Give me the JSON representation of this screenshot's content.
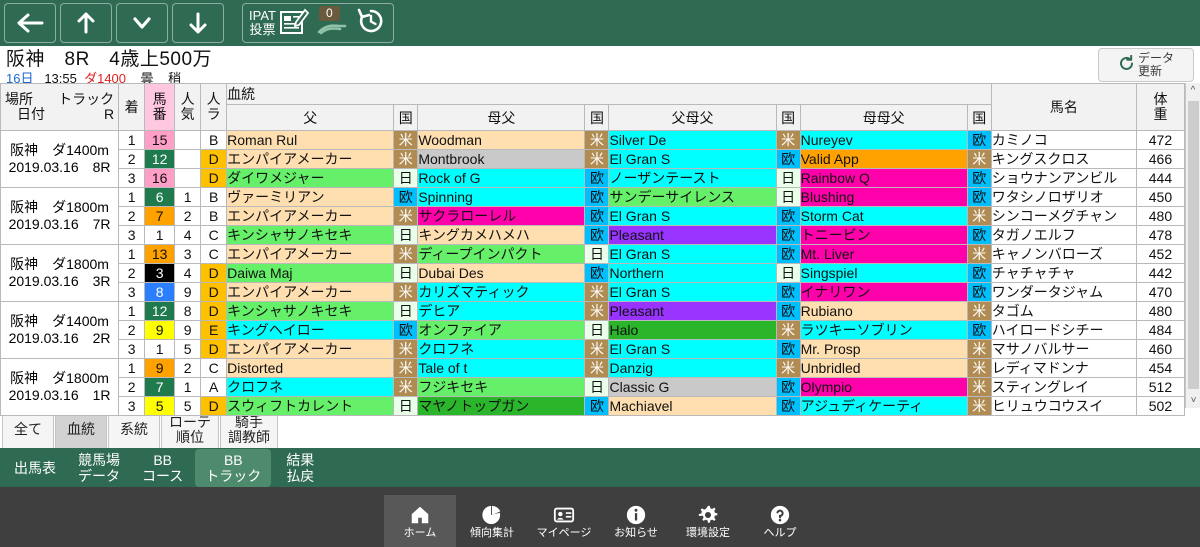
{
  "toolbar": {
    "back_label": "back-arrow",
    "up_label": "up-arrow",
    "down_chevron_label": "chevron-down",
    "down_label": "down-arrow",
    "ipat_line1": "IPAT",
    "ipat_line2": "投票",
    "badge_count": "0",
    "history_label": "history"
  },
  "race_header": {
    "title": "阪神　8R　4歳上500万",
    "day": "16日",
    "time": "13:55",
    "distance": "ダ1400",
    "weather": "曇",
    "track_condition": "稍",
    "refresh_line1": "データ",
    "refresh_line2": "更新"
  },
  "table": {
    "group_header": "血統",
    "headers": {
      "place": "場所",
      "track": "トラック",
      "date": "日付",
      "r": "R",
      "rank": "着",
      "horse_no": "馬番",
      "popularity": "人気",
      "running_style": "人ラ",
      "sire": "父",
      "country1": "国",
      "broodmare_sire": "母父",
      "country2": "国",
      "sire_of_dam_sire": "父母父",
      "country3": "国",
      "dam_of_dam_sire": "母母父",
      "country4": "国",
      "horse_name": "馬名",
      "weight": "体重"
    },
    "groups": [
      {
        "place": "阪神",
        "track": "ダ1400m",
        "date": "2019.03.16",
        "r": "8R",
        "rows": [
          {
            "rank": "1",
            "no": "15",
            "no_bg": "#ff9ec7",
            "no_color": "#111",
            "pop": "",
            "style": "B",
            "style_bg": "#ffffff",
            "style_color": "#111",
            "sire": "Roman Rul",
            "sire_bg": "#ffdfb0",
            "sire_color": "#111",
            "c1": "米",
            "c1_bg": "#b08b52",
            "c1_color": "#ffffff",
            "bms": "Woodman",
            "bms_bg": "#ffdfb0",
            "bms_color": "#111",
            "c2": "米",
            "c2_bg": "#b08b52",
            "c2_color": "#ffffff",
            "sds": "Silver De",
            "sds_bg": "#00ffff",
            "sds_color": "#111",
            "c3": "米",
            "c3_bg": "#b08b52",
            "c3_color": "#ffffff",
            "dds": "Nureyev",
            "dds_bg": "#00ffff",
            "dds_color": "#111",
            "c4": "欧",
            "c4_bg": "#00bfff",
            "c4_color": "#111",
            "horse": "カミノコ",
            "weight": "472"
          },
          {
            "rank": "2",
            "no": "12",
            "no_bg": "#1f7a4d",
            "no_color": "#ffffff",
            "pop": "",
            "style": "D",
            "style_bg": "#ffc000",
            "style_color": "#111",
            "sire": "エンパイアメーカー",
            "sire_bg": "#ffdfb0",
            "sire_color": "#111",
            "c1": "米",
            "c1_bg": "#b08b52",
            "c1_color": "#ffffff",
            "bms": "Montbrook",
            "bms_bg": "#c9c9c9",
            "bms_color": "#111",
            "c2": "米",
            "c2_bg": "#b08b52",
            "c2_color": "#ffffff",
            "sds": "El Gran S",
            "sds_bg": "#00ffff",
            "sds_color": "#111",
            "c3": "欧",
            "c3_bg": "#00bfff",
            "c3_color": "#111",
            "dds": "Valid App",
            "dds_bg": "#ffa200",
            "dds_color": "#111",
            "c4": "米",
            "c4_bg": "#b08b52",
            "c4_color": "#ffffff",
            "horse": "キングスクロス",
            "weight": "466"
          },
          {
            "rank": "3",
            "no": "16",
            "no_bg": "#ff9ec7",
            "no_color": "#111",
            "pop": "",
            "style": "D",
            "style_bg": "#ffc000",
            "style_color": "#111",
            "sire": "ダイワメジャー",
            "sire_bg": "#66f06a",
            "sire_color": "#111",
            "c1": "日",
            "c1_bg": "#eaffea",
            "c1_color": "#111",
            "bms": "Rock of G",
            "bms_bg": "#00ffff",
            "bms_color": "#111",
            "c2": "欧",
            "c2_bg": "#00bfff",
            "c2_color": "#111",
            "sds": "ノーザンテースト",
            "sds_bg": "#00ffff",
            "sds_color": "#111",
            "c3": "日",
            "c3_bg": "#eaffea",
            "c3_color": "#111",
            "dds": "Rainbow Q",
            "dds_bg": "#ff00aa",
            "dds_color": "#111",
            "c4": "欧",
            "c4_bg": "#00bfff",
            "c4_color": "#111",
            "horse": "ショウナンアンビル",
            "weight": "444"
          }
        ]
      },
      {
        "place": "阪神",
        "track": "ダ1800m",
        "date": "2019.03.16",
        "r": "7R",
        "rows": [
          {
            "rank": "1",
            "no": "6",
            "no_bg": "#1f7a4d",
            "no_color": "#ffffff",
            "pop": "1",
            "style": "B",
            "style_bg": "#ffffff",
            "style_color": "#111",
            "sire": "ヴァーミリアン",
            "sire_bg": "#ffdfb0",
            "sire_color": "#111",
            "c1": "欧",
            "c1_bg": "#00bfff",
            "c1_color": "#111",
            "bms": "Spinning",
            "bms_bg": "#00ffff",
            "bms_color": "#111",
            "c2": "欧",
            "c2_bg": "#00bfff",
            "c2_color": "#111",
            "sds": "サンデーサイレンス",
            "sds_bg": "#66f06a",
            "sds_color": "#111",
            "c3": "日",
            "c3_bg": "#eaffea",
            "c3_color": "#111",
            "dds": "Blushing",
            "dds_bg": "#ff00aa",
            "dds_color": "#111",
            "c4": "欧",
            "c4_bg": "#00bfff",
            "c4_color": "#111",
            "horse": "ワタシノロザリオ",
            "weight": "450"
          },
          {
            "rank": "2",
            "no": "7",
            "no_bg": "#ffa200",
            "no_color": "#111",
            "pop": "2",
            "style": "B",
            "style_bg": "#ffffff",
            "style_color": "#111",
            "sire": "エンパイアメーカー",
            "sire_bg": "#ffdfb0",
            "sire_color": "#111",
            "c1": "米",
            "c1_bg": "#b08b52",
            "c1_color": "#ffffff",
            "bms": "サクラローレル",
            "bms_bg": "#ff00aa",
            "bms_color": "#111",
            "c2": "欧",
            "c2_bg": "#00bfff",
            "c2_color": "#111",
            "sds": "El Gran S",
            "sds_bg": "#00ffff",
            "sds_color": "#111",
            "c3": "欧",
            "c3_bg": "#00bfff",
            "c3_color": "#111",
            "dds": "Storm Cat",
            "dds_bg": "#00ffff",
            "dds_color": "#111",
            "c4": "米",
            "c4_bg": "#b08b52",
            "c4_color": "#ffffff",
            "horse": "シンコーメグチャン",
            "weight": "480"
          },
          {
            "rank": "3",
            "no": "1",
            "no_bg": "#ffffff",
            "no_color": "#111",
            "pop": "4",
            "style": "C",
            "style_bg": "#ffffff",
            "style_color": "#111",
            "sire": "キンシャサノキセキ",
            "sire_bg": "#66f06a",
            "sire_color": "#111",
            "c1": "日",
            "c1_bg": "#eaffea",
            "c1_color": "#111",
            "bms": "キングカメハメハ",
            "bms_bg": "#ffdfb0",
            "bms_color": "#111",
            "c2": "欧",
            "c2_bg": "#00bfff",
            "c2_color": "#111",
            "sds": "Pleasant",
            "sds_bg": "#9933ff",
            "sds_color": "#111",
            "c3": "欧",
            "c3_bg": "#00bfff",
            "c3_color": "#111",
            "dds": "トニービン",
            "dds_bg": "#ff00aa",
            "dds_color": "#111",
            "c4": "欧",
            "c4_bg": "#00bfff",
            "c4_color": "#111",
            "horse": "タガノエルフ",
            "weight": "478"
          }
        ]
      },
      {
        "place": "阪神",
        "track": "ダ1800m",
        "date": "2019.03.16",
        "r": "3R",
        "rows": [
          {
            "rank": "1",
            "no": "13",
            "no_bg": "#ffa200",
            "no_color": "#111",
            "pop": "3",
            "style": "C",
            "style_bg": "#ffffff",
            "style_color": "#111",
            "sire": "エンパイアメーカー",
            "sire_bg": "#ffdfb0",
            "sire_color": "#111",
            "c1": "米",
            "c1_bg": "#b08b52",
            "c1_color": "#ffffff",
            "bms": "ディープインパクト",
            "bms_bg": "#66f06a",
            "bms_color": "#111",
            "c2": "日",
            "c2_bg": "#eaffea",
            "c2_color": "#111",
            "sds": "El Gran S",
            "sds_bg": "#00ffff",
            "sds_color": "#111",
            "c3": "欧",
            "c3_bg": "#00bfff",
            "c3_color": "#111",
            "dds": "Mt. Liver",
            "dds_bg": "#ff00aa",
            "dds_color": "#111",
            "c4": "米",
            "c4_bg": "#b08b52",
            "c4_color": "#ffffff",
            "horse": "キャノンバローズ",
            "weight": "452"
          },
          {
            "rank": "2",
            "no": "3",
            "no_bg": "#000000",
            "no_color": "#ffffff",
            "pop": "4",
            "style": "D",
            "style_bg": "#ffc000",
            "style_color": "#111",
            "sire": "Daiwa Maj",
            "sire_bg": "#66f06a",
            "sire_color": "#111",
            "c1": "日",
            "c1_bg": "#eaffea",
            "c1_color": "#111",
            "bms": "Dubai Des",
            "bms_bg": "#ffdfb0",
            "bms_color": "#111",
            "c2": "欧",
            "c2_bg": "#00bfff",
            "c2_color": "#111",
            "sds": "Northern",
            "sds_bg": "#00ffff",
            "sds_color": "#111",
            "c3": "日",
            "c3_bg": "#eaffea",
            "c3_color": "#111",
            "dds": "Singspiel",
            "dds_bg": "#00ffff",
            "dds_color": "#111",
            "c4": "欧",
            "c4_bg": "#00bfff",
            "c4_color": "#111",
            "horse": "チャチャチャ",
            "weight": "442"
          },
          {
            "rank": "3",
            "no": "8",
            "no_bg": "#2b7fff",
            "no_color": "#ffffff",
            "pop": "9",
            "style": "D",
            "style_bg": "#ffc000",
            "style_color": "#111",
            "sire": "エンパイアメーカー",
            "sire_bg": "#ffdfb0",
            "sire_color": "#111",
            "c1": "米",
            "c1_bg": "#b08b52",
            "c1_color": "#ffffff",
            "bms": "カリズマティック",
            "bms_bg": "#00ffff",
            "bms_color": "#111",
            "c2": "米",
            "c2_bg": "#b08b52",
            "c2_color": "#ffffff",
            "sds": "El Gran S",
            "sds_bg": "#00ffff",
            "sds_color": "#111",
            "c3": "欧",
            "c3_bg": "#00bfff",
            "c3_color": "#111",
            "dds": "イナリワン",
            "dds_bg": "#ff00aa",
            "dds_color": "#111",
            "c4": "欧",
            "c4_bg": "#00bfff",
            "c4_color": "#111",
            "horse": "ワンダータジャム",
            "weight": "470"
          }
        ]
      },
      {
        "place": "阪神",
        "track": "ダ1400m",
        "date": "2019.03.16",
        "r": "2R",
        "rows": [
          {
            "rank": "1",
            "no": "12",
            "no_bg": "#1f7a4d",
            "no_color": "#ffffff",
            "pop": "8",
            "style": "D",
            "style_bg": "#ffc000",
            "style_color": "#111",
            "sire": "キンシャサノキセキ",
            "sire_bg": "#66f06a",
            "sire_color": "#111",
            "c1": "日",
            "c1_bg": "#eaffea",
            "c1_color": "#111",
            "bms": "デヒア",
            "bms_bg": "#00ffff",
            "bms_color": "#111",
            "c2": "米",
            "c2_bg": "#b08b52",
            "c2_color": "#ffffff",
            "sds": "Pleasant",
            "sds_bg": "#9933ff",
            "sds_color": "#111",
            "c3": "欧",
            "c3_bg": "#00bfff",
            "c3_color": "#111",
            "dds": "Rubiano",
            "dds_bg": "#ffdfb0",
            "dds_color": "#111",
            "c4": "米",
            "c4_bg": "#b08b52",
            "c4_color": "#ffffff",
            "horse": "タゴム",
            "weight": "480"
          },
          {
            "rank": "2",
            "no": "9",
            "no_bg": "#ffff00",
            "no_color": "#111",
            "pop": "9",
            "style": "E",
            "style_bg": "#ffc000",
            "style_color": "#111",
            "sire": "キングヘイロー",
            "sire_bg": "#00ffff",
            "sire_color": "#111",
            "c1": "欧",
            "c1_bg": "#00bfff",
            "c1_color": "#111",
            "bms": "オンファイア",
            "bms_bg": "#66f06a",
            "bms_color": "#111",
            "c2": "日",
            "c2_bg": "#eaffea",
            "c2_color": "#111",
            "sds": "Halo",
            "sds_bg": "#2bb52b",
            "sds_color": "#111",
            "c3": "米",
            "c3_bg": "#b08b52",
            "c3_color": "#ffffff",
            "dds": "ラツキーソブリン",
            "dds_bg": "#00ffff",
            "dds_color": "#111",
            "c4": "欧",
            "c4_bg": "#00bfff",
            "c4_color": "#111",
            "horse": "ハイロードシチー",
            "weight": "484"
          },
          {
            "rank": "3",
            "no": "1",
            "no_bg": "#ffffff",
            "no_color": "#111",
            "pop": "5",
            "style": "D",
            "style_bg": "#ffc000",
            "style_color": "#111",
            "sire": "エンパイアメーカー",
            "sire_bg": "#ffdfb0",
            "sire_color": "#111",
            "c1": "米",
            "c1_bg": "#b08b52",
            "c1_color": "#ffffff",
            "bms": "クロフネ",
            "bms_bg": "#00ffff",
            "bms_color": "#111",
            "c2": "米",
            "c2_bg": "#b08b52",
            "c2_color": "#ffffff",
            "sds": "El Gran S",
            "sds_bg": "#00ffff",
            "sds_color": "#111",
            "c3": "欧",
            "c3_bg": "#00bfff",
            "c3_color": "#111",
            "dds": "Mr. Prosp",
            "dds_bg": "#ffdfb0",
            "dds_color": "#111",
            "c4": "米",
            "c4_bg": "#b08b52",
            "c4_color": "#ffffff",
            "horse": "マサノバルサー",
            "weight": "460"
          }
        ]
      },
      {
        "place": "阪神",
        "track": "ダ1800m",
        "date": "2019.03.16",
        "r": "1R",
        "rows": [
          {
            "rank": "1",
            "no": "9",
            "no_bg": "#ffa200",
            "no_color": "#111",
            "pop": "2",
            "style": "C",
            "style_bg": "#ffffff",
            "style_color": "#111",
            "sire": "Distorted",
            "sire_bg": "#ffdfb0",
            "sire_color": "#111",
            "c1": "米",
            "c1_bg": "#b08b52",
            "c1_color": "#ffffff",
            "bms": "Tale of t",
            "bms_bg": "#00ffff",
            "bms_color": "#111",
            "c2": "米",
            "c2_bg": "#b08b52",
            "c2_color": "#ffffff",
            "sds": "Danzig",
            "sds_bg": "#00ffff",
            "sds_color": "#111",
            "c3": "米",
            "c3_bg": "#b08b52",
            "c3_color": "#ffffff",
            "dds": "Unbridled",
            "dds_bg": "#ffdfb0",
            "dds_color": "#111",
            "c4": "米",
            "c4_bg": "#b08b52",
            "c4_color": "#ffffff",
            "horse": "レディマドンナ",
            "weight": "454"
          },
          {
            "rank": "2",
            "no": "7",
            "no_bg": "#1f7a4d",
            "no_color": "#ffffff",
            "pop": "1",
            "style": "A",
            "style_bg": "#ffffff",
            "style_color": "#111",
            "sire": "クロフネ",
            "sire_bg": "#00ffff",
            "sire_color": "#111",
            "c1": "米",
            "c1_bg": "#b08b52",
            "c1_color": "#ffffff",
            "bms": "フジキセキ",
            "bms_bg": "#66f06a",
            "bms_color": "#111",
            "c2": "日",
            "c2_bg": "#eaffea",
            "c2_color": "#111",
            "sds": "Classic G",
            "sds_bg": "#c9c9c9",
            "sds_color": "#111",
            "c3": "欧",
            "c3_bg": "#00bfff",
            "c3_color": "#111",
            "dds": "Olympio",
            "dds_bg": "#ff00aa",
            "dds_color": "#111",
            "c4": "米",
            "c4_bg": "#b08b52",
            "c4_color": "#ffffff",
            "horse": "スティングレイ",
            "weight": "512"
          },
          {
            "rank": "3",
            "no": "5",
            "no_bg": "#ffff00",
            "no_color": "#111",
            "pop": "5",
            "style": "D",
            "style_bg": "#ffc000",
            "style_color": "#111",
            "sire": "スウィフトカレント",
            "sire_bg": "#66f06a",
            "sire_color": "#111",
            "c1": "日",
            "c1_bg": "#eaffea",
            "c1_color": "#111",
            "bms": "マヤノトップガン",
            "bms_bg": "#2bb52b",
            "bms_color": "#111",
            "c2": "欧",
            "c2_bg": "#00bfff",
            "c2_color": "#111",
            "sds": "Machiavel",
            "sds_bg": "#ffdfb0",
            "sds_color": "#111",
            "c3": "欧",
            "c3_bg": "#00bfff",
            "c3_color": "#111",
            "dds": "アジュディケーティ",
            "dds_bg": "#00ffff",
            "dds_color": "#111",
            "c4": "米",
            "c4_bg": "#b08b52",
            "c4_color": "#ffffff",
            "horse": "ヒリュウコウスイ",
            "weight": "502"
          }
        ]
      }
    ]
  },
  "sub_tabs": [
    {
      "label": "全て",
      "active": false
    },
    {
      "label": "血統",
      "active": true
    },
    {
      "label": "系統",
      "active": false
    },
    {
      "line1": "ローテ",
      "line2": "順位",
      "active": false
    },
    {
      "line1": "騎手",
      "line2": "調教師",
      "active": false
    }
  ],
  "green_tabs": [
    {
      "label": "出馬表",
      "active": false
    },
    {
      "line1": "競馬場",
      "line2": "データ",
      "active": false
    },
    {
      "line1": "BB",
      "line2": "コース",
      "active": false
    },
    {
      "line1": "BB",
      "line2": "トラック",
      "active": true
    },
    {
      "line1": "結果",
      "line2": "払戻",
      "active": false
    }
  ],
  "bottom_nav": [
    {
      "label": "ホーム",
      "icon": "home-icon",
      "active": true
    },
    {
      "label": "傾向集計",
      "icon": "pie-chart-icon",
      "active": false
    },
    {
      "label": "マイページ",
      "icon": "id-card-icon",
      "active": false
    },
    {
      "label": "お知らせ",
      "icon": "info-icon",
      "active": false
    },
    {
      "label": "環境設定",
      "icon": "gear-icon",
      "active": false
    },
    {
      "label": "ヘルプ",
      "icon": "question-icon",
      "active": false
    }
  ]
}
